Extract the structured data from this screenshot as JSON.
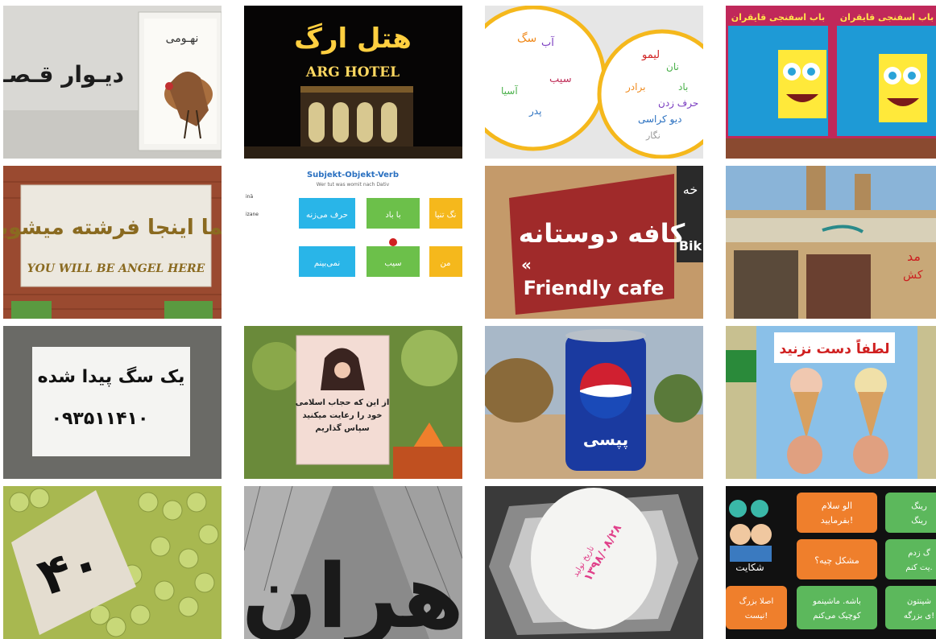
{
  "tiles": [
    {
      "id": "story-wall",
      "texts": [
        "دیـوار قـصـه",
        "نهـومی"
      ]
    },
    {
      "id": "arg-hotel",
      "texts": [
        "هتل ارگ",
        "ARG HOTEL"
      ]
    },
    {
      "id": "word-circles",
      "texts": [
        "سگ",
        "سیب",
        "آب",
        "پدر",
        "آسیا",
        "نان",
        "لیمو",
        "باد",
        "حرف زدن",
        "برادر",
        "دیو کراسی",
        "نگار"
      ]
    },
    {
      "id": "spongebob-sign",
      "texts": [
        "باب اسفنجی قایقران",
        "باب اسفنجی قایقران"
      ]
    },
    {
      "id": "angel-sign",
      "texts": [
        "شما اینجا فرشته میشوید",
        "YOU WILL BE ANGEL HERE"
      ]
    },
    {
      "id": "sov-slide",
      "texts": [
        "Subjekt-Objekt-Verb",
        "Wer tut was womit nach Dativ",
        "حرف می‌زنه",
        "با باد",
        "نگ تنیا",
        "نمی‌بینم",
        "سیب",
        "من",
        "inä",
        "izane"
      ]
    },
    {
      "id": "friendly-cafe",
      "texts": [
        "کافه دوستانه",
        "Friendly cafe",
        "Bik",
        "خه"
      ]
    },
    {
      "id": "yazd-street",
      "texts": [
        "مد",
        "کش"
      ]
    },
    {
      "id": "lost-dog",
      "texts": [
        "یک سگ پیدا شده",
        "۰۹۳۵۱۱۴۱۰"
      ]
    },
    {
      "id": "hijab-sign",
      "texts": [
        "از این که حجاب اسلامی",
        "خود را رعایت میکنید",
        "سپاس گذاریم"
      ]
    },
    {
      "id": "pepsi-can",
      "texts": [
        "پپسی"
      ]
    },
    {
      "id": "dont-touch",
      "texts": [
        "لطفاً دست نزنید"
      ]
    },
    {
      "id": "grapes-price",
      "texts": [
        "۴۰"
      ]
    },
    {
      "id": "tehran-letters",
      "texts": [
        "هران"
      ]
    },
    {
      "id": "egg-stamp",
      "texts": [
        "۱۳۹۸/۰۸/۲۸",
        "تاریخ تولید"
      ]
    },
    {
      "id": "complaint-dialog",
      "texts": [
        "الو سلام",
        "بفرمایید!",
        "مشکل چیه؟",
        "باشه. ماشینمو",
        "کوچیک می‌کنم",
        "اصلا بزرگ",
        "نیست!",
        "شکایت",
        "رینگ",
        "رینگ",
        "گ زدم",
        "یت کنم.",
        "شینتون",
        "ی بزرگه!"
      ]
    }
  ],
  "colors": {
    "accent_yellow": "#f5b81c",
    "green_box": "#6cc04a",
    "blue_box": "#29b5e8",
    "cafe_red": "#a02a2a",
    "sticky_orange": "#ef7f2c",
    "sticky_green": "#5cb85c"
  }
}
